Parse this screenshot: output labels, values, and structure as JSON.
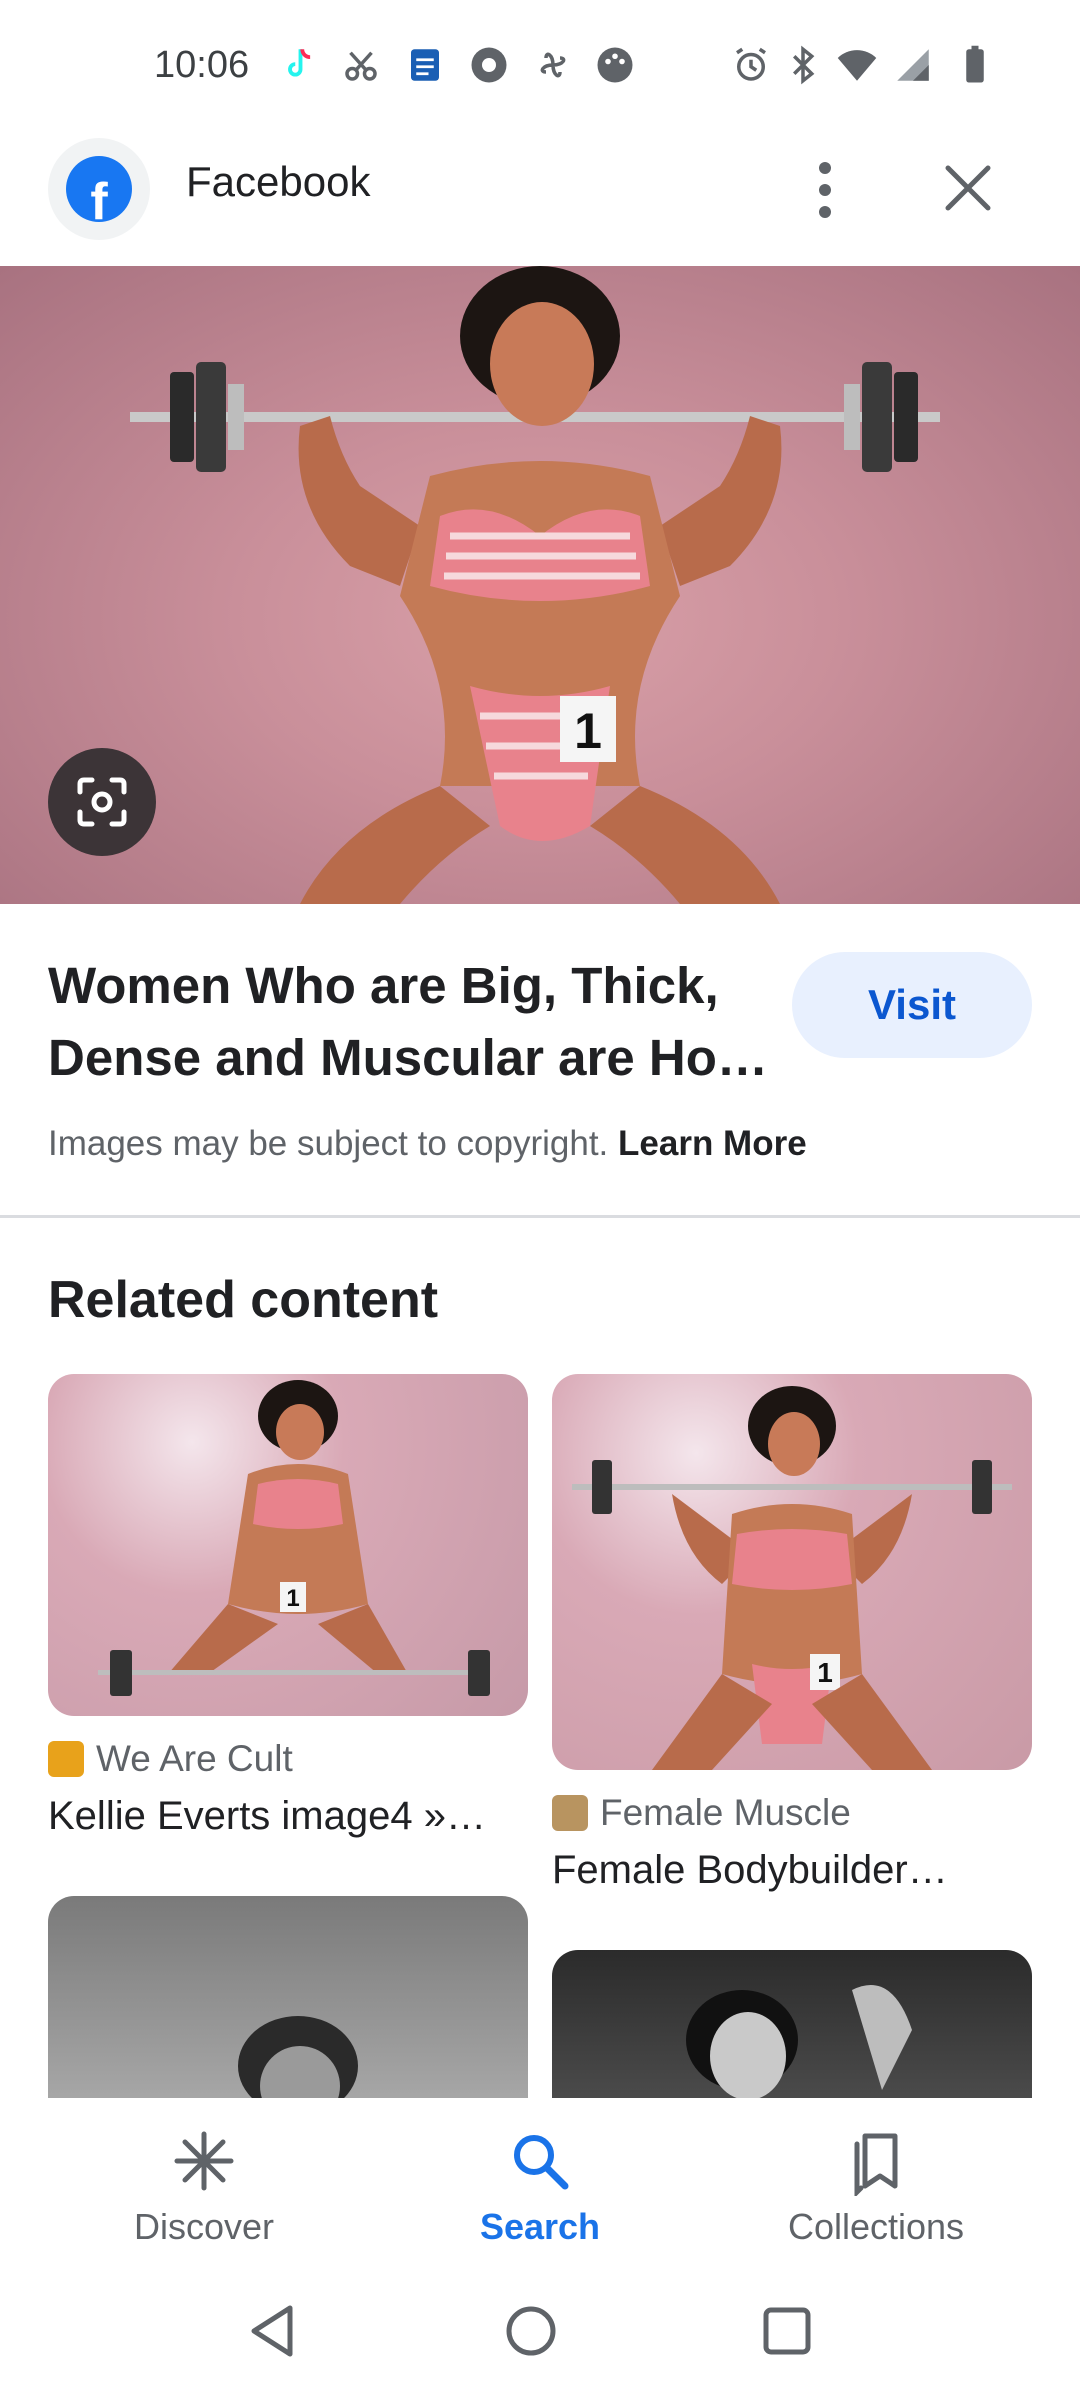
{
  "status_bar": {
    "time": "10:06",
    "notification_icons": [
      "tiktok-icon",
      "scissors-icon",
      "docs-icon",
      "chrome-icon",
      "pinwheel-icon",
      "game-icon"
    ],
    "system_icons": [
      "alarm-icon",
      "bluetooth-icon",
      "wifi-icon",
      "signal-icon",
      "battery-icon"
    ]
  },
  "header": {
    "site_name": "Facebook",
    "site_logo_letter": "f"
  },
  "result": {
    "title": "Women Who are Big, Thick, Dense and Muscular are Ho…",
    "visit_label": "Visit",
    "copyright_text": "Images may be subject to copyright.",
    "learn_more_label": "Learn More"
  },
  "related": {
    "heading": "Related content",
    "cards": [
      {
        "source": "We Are Cult",
        "title": "Kellie Everts image4 »…",
        "favicon_color": "#e8a21b"
      },
      {
        "source": "Female Muscle",
        "title": "Female Bodybuilder…",
        "favicon_color": "#b89460"
      }
    ]
  },
  "bottom_nav": {
    "items": [
      {
        "label": "Discover",
        "icon": "asterisk-icon",
        "active": false
      },
      {
        "label": "Search",
        "icon": "search-icon",
        "active": true
      },
      {
        "label": "Collections",
        "icon": "bookmarks-icon",
        "active": false
      }
    ]
  },
  "colors": {
    "accent": "#1a73e8",
    "visit_bg": "#e8f0fe",
    "visit_text": "#0b57d0"
  }
}
